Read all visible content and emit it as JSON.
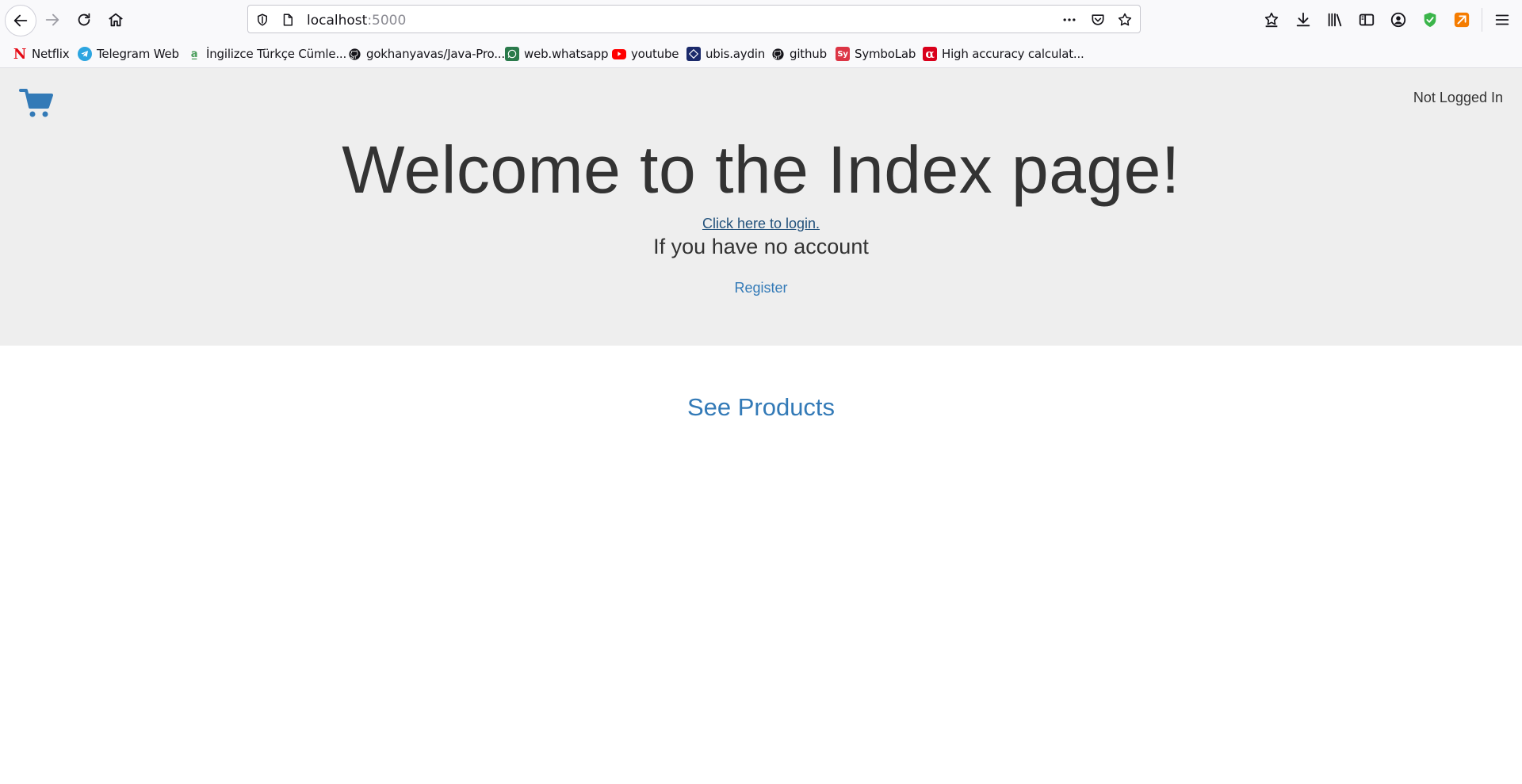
{
  "browser": {
    "url_host": "localhost",
    "url_port": ":5000",
    "toolbar_icons": [
      "back-icon",
      "forward-icon",
      "reload-icon",
      "home-icon",
      "shield-icon",
      "page-icon",
      "more-icon",
      "pocket-icon",
      "bookmark-star-icon",
      "bookmarks-icon",
      "download-icon",
      "library-icon",
      "sidebar-icon",
      "account-icon",
      "extension-shield-icon",
      "extension-icon",
      "menu-icon"
    ]
  },
  "bookmarks": [
    {
      "label": "Netflix",
      "icon": "netflix-icon"
    },
    {
      "label": "Telegram Web",
      "icon": "telegram-icon"
    },
    {
      "label": "İngilizce Türkçe Cümle...",
      "icon": "translate-icon"
    },
    {
      "label": "gokhanyavas/Java-Pro...",
      "icon": "github-icon"
    },
    {
      "label": "web.whatsapp",
      "icon": "whatsapp-icon"
    },
    {
      "label": "youtube",
      "icon": "youtube-icon"
    },
    {
      "label": "ubis.aydin",
      "icon": "ubis-icon"
    },
    {
      "label": "github",
      "icon": "github-icon"
    },
    {
      "label": "SymboLab",
      "icon": "symbolab-icon"
    },
    {
      "label": "High accuracy calculat...",
      "icon": "alpha-icon"
    }
  ],
  "page": {
    "cart_icon": "shopping-cart-icon",
    "login_status": "Not Logged In",
    "title": "Welcome to the Index page!",
    "login_link": "Click here to login.",
    "no_account_text": "If you have no account",
    "register_link": "Register",
    "products_link": "See Products"
  },
  "colors": {
    "link": "#337ab7",
    "link_visited": "#23527c",
    "jumbotron_bg": "#eeeeee",
    "text": "#333333"
  }
}
